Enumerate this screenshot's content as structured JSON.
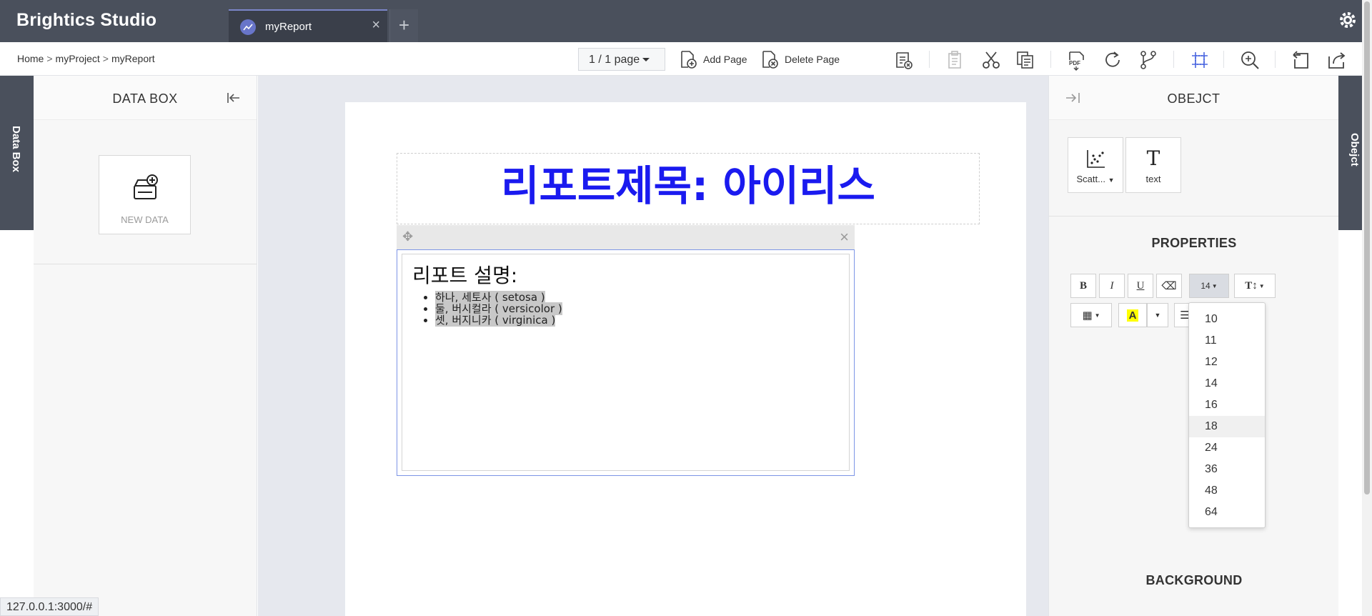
{
  "app": {
    "brand": "Brightics Studio"
  },
  "tabs": [
    {
      "label": "myReport"
    }
  ],
  "breadcrumb": {
    "items": [
      "Home",
      "myProject",
      "myReport"
    ]
  },
  "toolbar": {
    "page_indicator": "1 / 1 page",
    "add_page_label": "Add Page",
    "delete_page_label": "Delete Page",
    "icons": [
      "report-delete-icon",
      "paste-icon",
      "cut-icon",
      "copy-icon",
      "pdf-export-icon",
      "refresh-icon",
      "branch-icon",
      "fit-frame-icon",
      "zoom-in-icon",
      "undo-icon",
      "share-icon"
    ]
  },
  "left_panel": {
    "tab_label": "Data Box",
    "title": "DATA BOX",
    "new_data_label": "NEW DATA"
  },
  "report": {
    "title": "리포트제목: 아이리스",
    "description_heading": "리포트 설명:",
    "items": [
      "하나, 세토사 ( setosa )",
      "둘, 버시컬라 ( versicolor )",
      "셋, 버지니카 ( virginica )"
    ],
    "title_color": "#1a1aef"
  },
  "right_panel": {
    "tab_label": "Obejct",
    "title": "OBEJCT",
    "objects": [
      {
        "label": "Scatt..."
      },
      {
        "label": "text"
      }
    ],
    "properties_title": "PROPERTIES",
    "background_title": "BACKGROUND",
    "format": {
      "bold": "B",
      "italic": "I",
      "underline": "U",
      "font_size": "14",
      "text_height": "T↕",
      "highlight": "A"
    }
  },
  "font_size_dropdown": {
    "options": [
      "10",
      "11",
      "12",
      "14",
      "16",
      "18",
      "24",
      "36",
      "48",
      "64"
    ],
    "hovered": "18"
  },
  "status_url": "127.0.0.1:3000/#"
}
